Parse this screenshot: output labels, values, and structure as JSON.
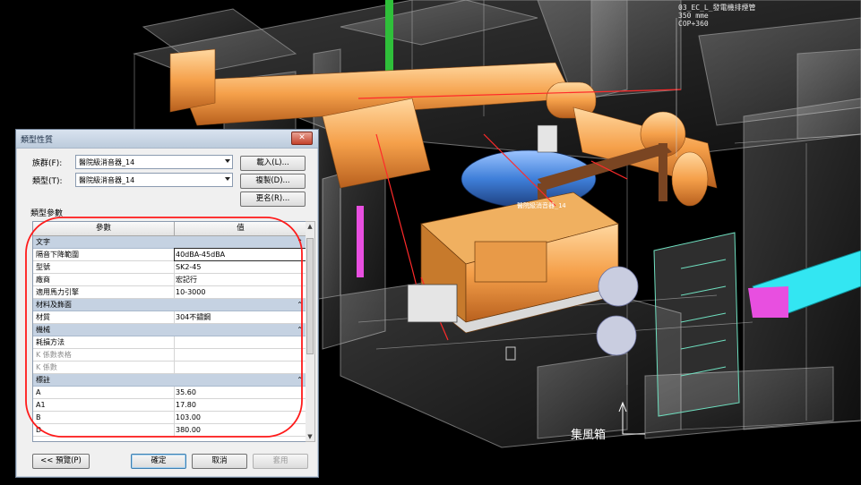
{
  "viewport": {
    "tag_top": "03_EC_L_發電機排煙管",
    "tag_size": "350 mme",
    "tag_cop": "COP+360",
    "model_tag": "醫院級消音器_14",
    "callout": "集風箱"
  },
  "dialog": {
    "title": "類型性質",
    "close": "✕",
    "family_label": "族群(F):",
    "family_value": "醫院級消音器_14",
    "type_label": "類型(T):",
    "type_value": "醫院級消音器_14",
    "load_button": "載入(L)...",
    "duplicate_button": "複製(D)...",
    "rename_button": "更名(R)...",
    "section_label": "類型參數",
    "columns": {
      "param": "參數",
      "value": "值"
    },
    "groups": [
      {
        "name": "文字",
        "rows": [
          {
            "param": "隔音下降範圍",
            "value": "40dBA-45dBA"
          },
          {
            "param": "型號",
            "value": "SK2-45"
          },
          {
            "param": "廠商",
            "value": "宏記行"
          },
          {
            "param": "適用馬力引擎",
            "value": "10-3000"
          }
        ]
      },
      {
        "name": "材料及飾面",
        "rows": [
          {
            "param": "材質",
            "value": "304不鏽鋼"
          }
        ]
      },
      {
        "name": "機械",
        "rows": [
          {
            "param": "耗損方法",
            "value": ""
          },
          {
            "param": "K 係數表格",
            "value": ""
          },
          {
            "param": "K 係數",
            "value": ""
          }
        ]
      },
      {
        "name": "標註",
        "rows": [
          {
            "param": "A",
            "value": "35.60"
          },
          {
            "param": "A1",
            "value": "17.80"
          },
          {
            "param": "B",
            "value": "103.00"
          },
          {
            "param": "D",
            "value": "380.00"
          }
        ]
      }
    ],
    "chevron": "⌃",
    "preview_button": "<< 預覽(P)",
    "ok_button": "確定",
    "cancel_button": "取消",
    "apply_button": "套用"
  },
  "colors": {
    "background": "#000000",
    "equipment": "#f5a04a",
    "tank": "#3f7fd9",
    "duct_cyan": "#33e6f2",
    "duct_magenta": "#e84fe0",
    "annotation": "#ff1a1a"
  }
}
